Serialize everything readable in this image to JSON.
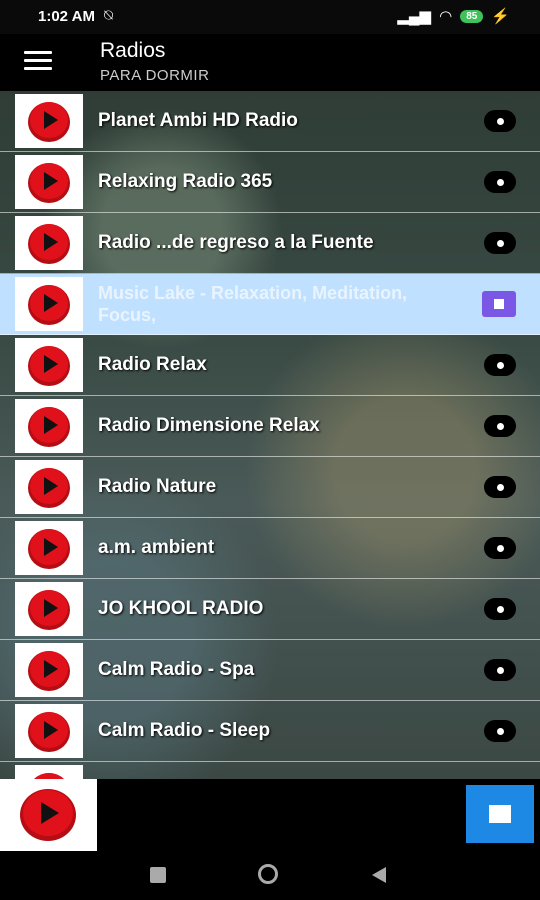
{
  "status_bar": {
    "time": "1:02 AM",
    "battery": "85"
  },
  "app_bar": {
    "title": "Radios",
    "subtitle": "PARA DORMIR"
  },
  "stations": [
    {
      "name": "Planet Ambi HD Radio"
    },
    {
      "name": "Relaxing Radio 365"
    },
    {
      "name": "Radio ...de regreso a la Fuente"
    },
    {
      "name": "Music Lake - Relaxation, Meditation, Focus,",
      "selected": true
    },
    {
      "name": "Radio Relax"
    },
    {
      "name": "Radio Dimensione Relax"
    },
    {
      "name": "Radio Nature"
    },
    {
      "name": "a.m. ambient"
    },
    {
      "name": "JO KHOOL RADIO"
    },
    {
      "name": "Calm Radio - Spa"
    },
    {
      "name": "Calm Radio - Sleep"
    }
  ],
  "colors": {
    "accent_stop": "#1e88e5",
    "selected_row": "#bfe0ff",
    "stop_badge": "#7b57e6",
    "play_red": "#e0111a"
  }
}
